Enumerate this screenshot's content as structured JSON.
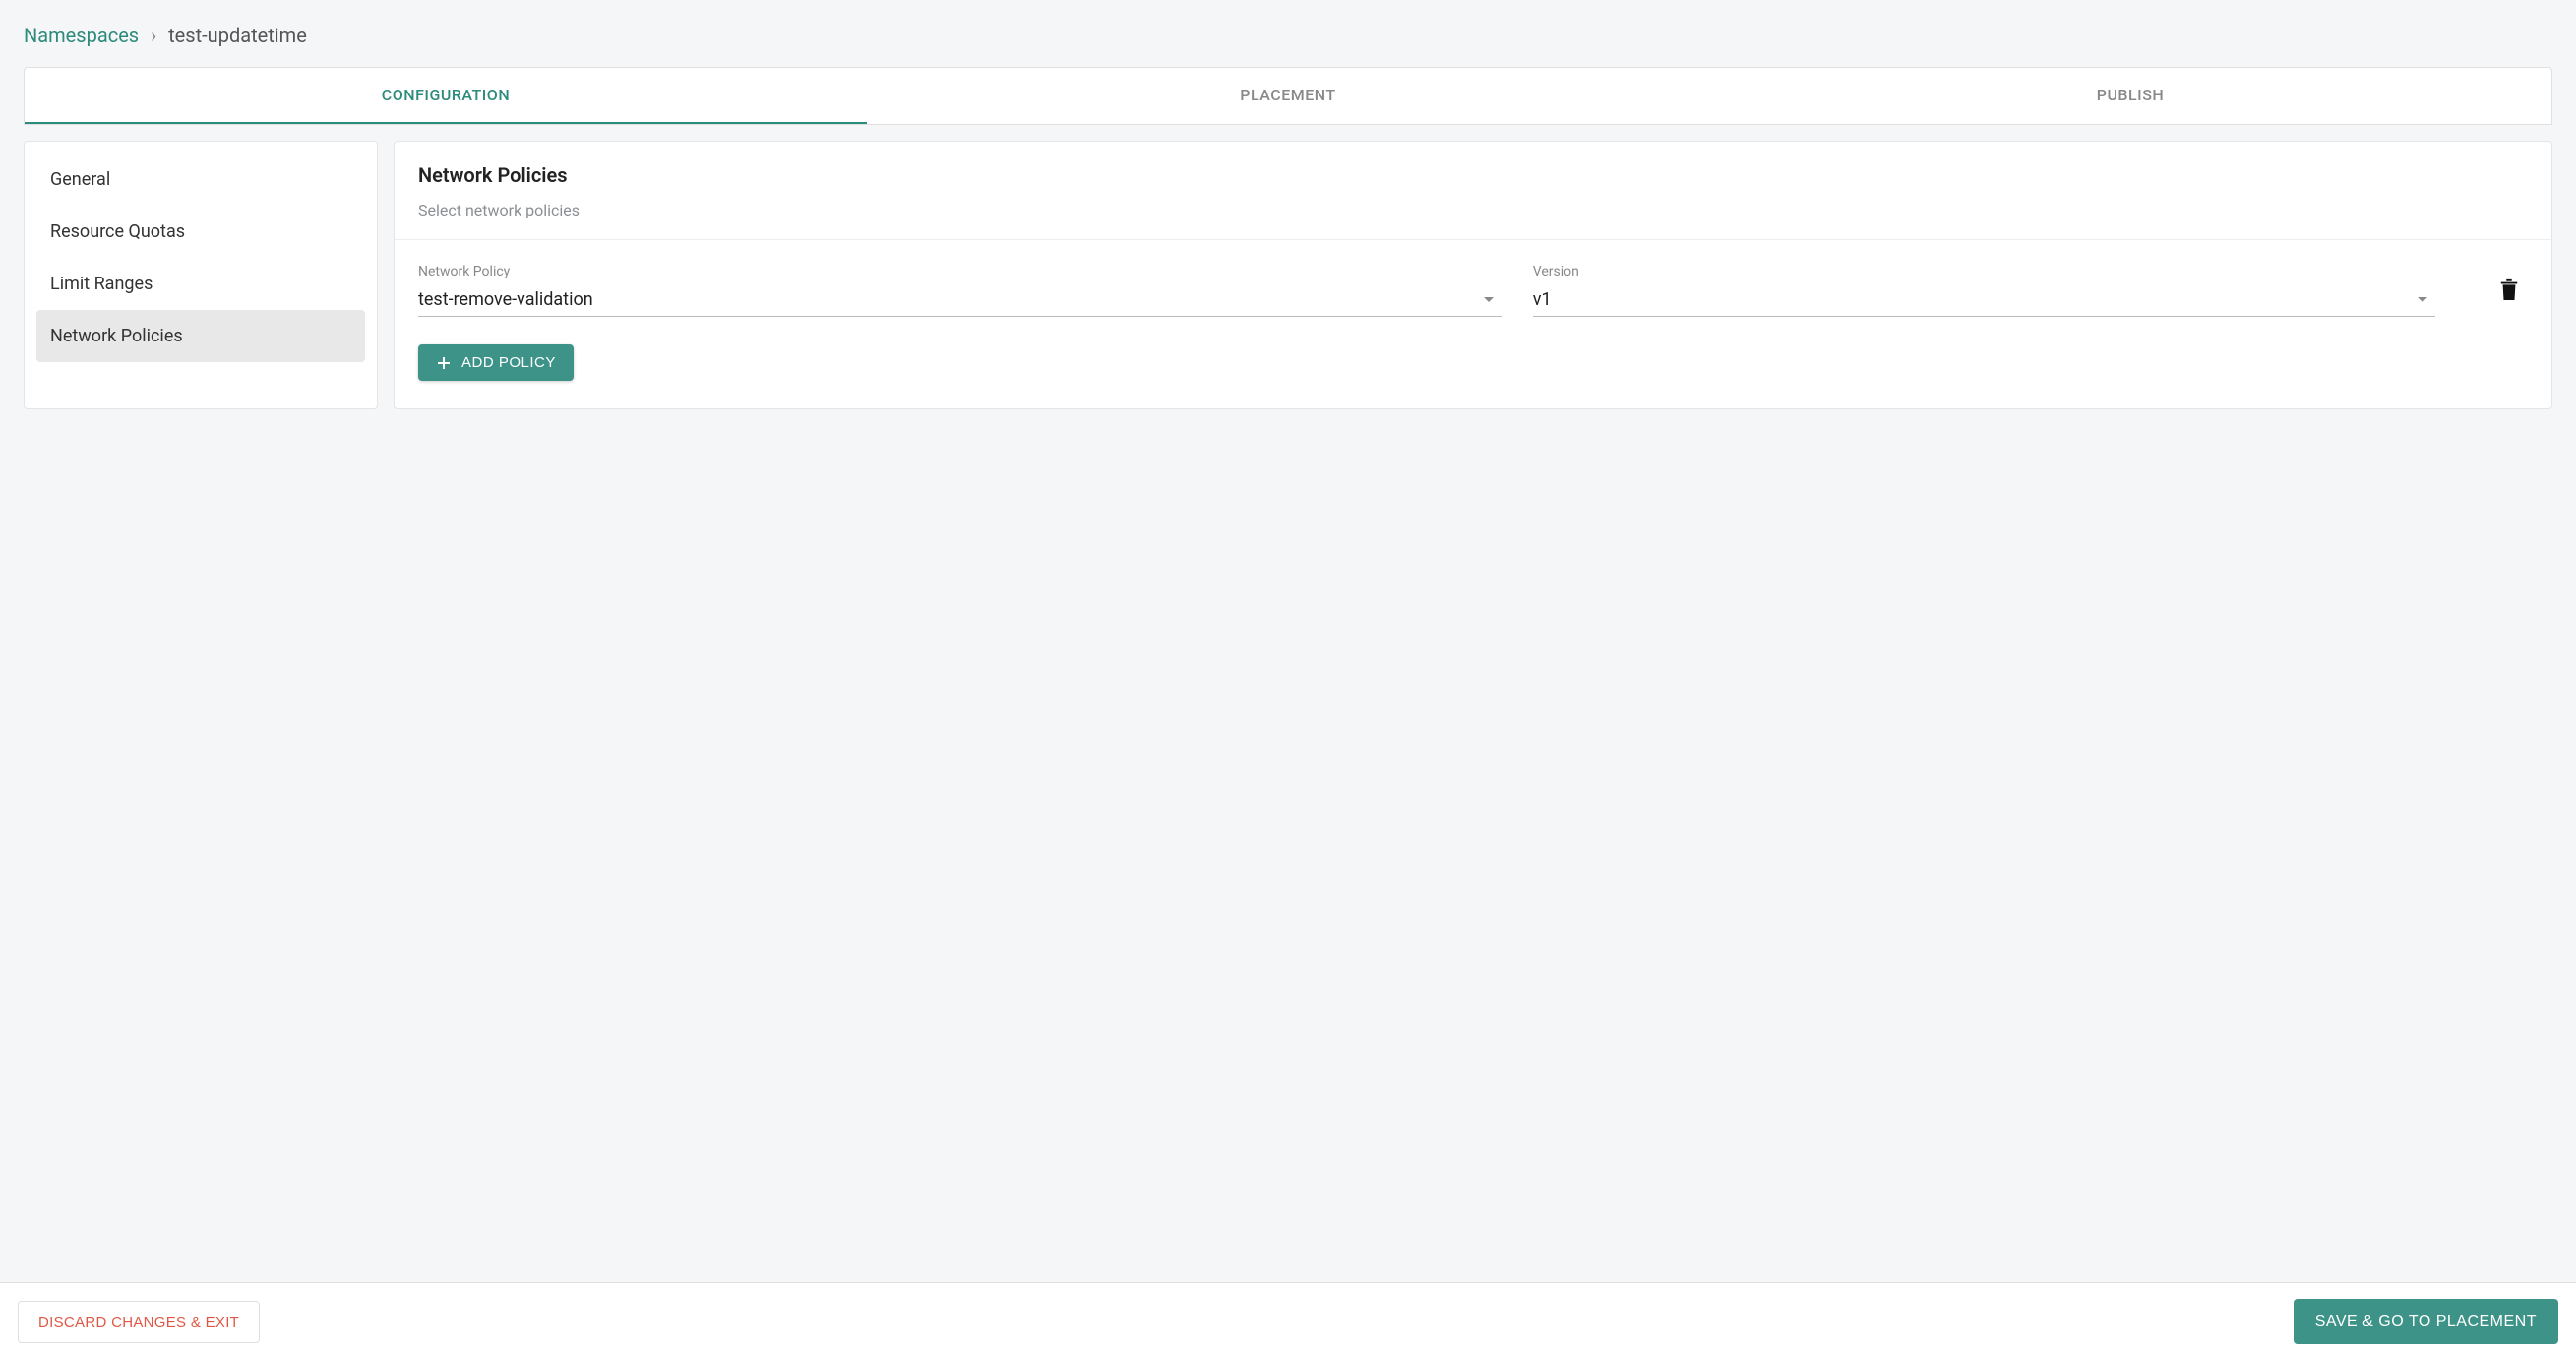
{
  "breadcrumb": {
    "parent": "Namespaces",
    "separator": "›",
    "current": "test-updatetime"
  },
  "tabs": [
    {
      "label": "CONFIGURATION",
      "active": true
    },
    {
      "label": "PLACEMENT",
      "active": false
    },
    {
      "label": "PUBLISH",
      "active": false
    }
  ],
  "sidebar": {
    "items": [
      {
        "label": "General",
        "active": false
      },
      {
        "label": "Resource Quotas",
        "active": false
      },
      {
        "label": "Limit Ranges",
        "active": false
      },
      {
        "label": "Network Policies",
        "active": true
      }
    ]
  },
  "panel": {
    "title": "Network Policies",
    "subtitle": "Select network policies"
  },
  "policyRow": {
    "policy": {
      "label": "Network Policy",
      "value": "test-remove-validation"
    },
    "version": {
      "label": "Version",
      "value": "v1"
    }
  },
  "buttons": {
    "addPolicy": "ADD POLICY",
    "discard": "DISCARD CHANGES & EXIT",
    "save": "SAVE & GO TO PLACEMENT"
  }
}
